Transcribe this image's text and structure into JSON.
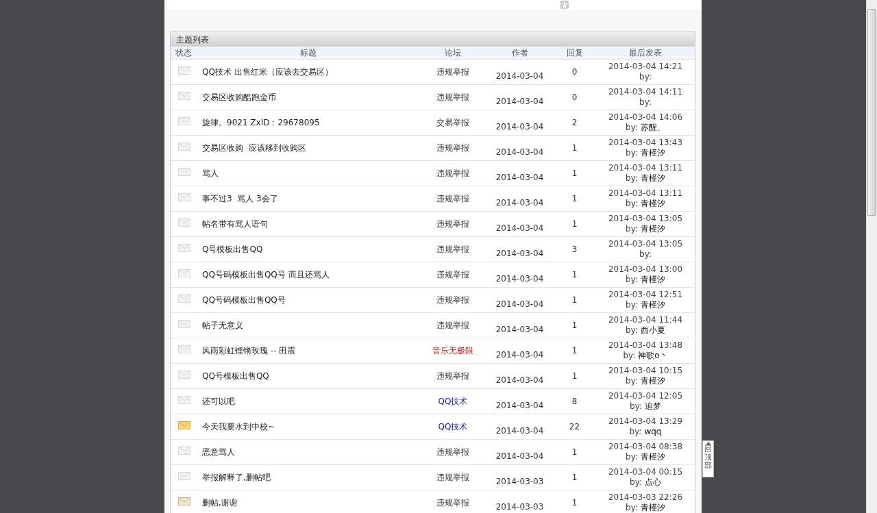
{
  "panel": {
    "title": "主题列表"
  },
  "columns": [
    "状态",
    "标题",
    "论坛",
    "作者",
    "回复",
    "最后发表"
  ],
  "rows": [
    {
      "kind": "plain",
      "title": "QQ技术 出售红米（应该去交易区）",
      "forum": "违规举报",
      "date": "2014-03-04",
      "replies": "0",
      "last_time": "2014-03-04 14:21",
      "by": "by:"
    },
    {
      "kind": "plain",
      "title": "交易区收购酷跑金币",
      "forum": "违规举报",
      "date": "2014-03-04",
      "replies": "0",
      "last_time": "2014-03-04 14:11",
      "by": "by:"
    },
    {
      "kind": "plain",
      "title": "旋律。9021 ZxID：29678095",
      "forum": "交易举报",
      "date": "2014-03-04",
      "replies": "2",
      "last_time": "2014-03-04 14:06",
      "by": "by:",
      "last_author": "苏醒、"
    },
    {
      "kind": "plain",
      "title": "交易区收购  应该移到收购区",
      "forum": "违规举报",
      "date": "2014-03-04",
      "replies": "1",
      "last_time": "2014-03-04 13:43",
      "by": "by:",
      "last_author": "青槿汐"
    },
    {
      "kind": "plain",
      "title": "骂人",
      "forum": "违规举报",
      "date": "2014-03-04",
      "replies": "1",
      "last_time": "2014-03-04 13:11",
      "by": "by:",
      "last_author": "青槿汐"
    },
    {
      "kind": "plain",
      "title": "事不过3  骂人 3会了",
      "forum": "违规举报",
      "date": "2014-03-04",
      "replies": "1",
      "last_time": "2014-03-04 13:11",
      "by": "by:",
      "last_author": "青槿汐"
    },
    {
      "kind": "plain",
      "title": "帖名带有骂人语句",
      "forum": "违规举报",
      "date": "2014-03-04",
      "replies": "1",
      "last_time": "2014-03-04 13:05",
      "by": "by:",
      "last_author": "青槿汐"
    },
    {
      "kind": "plain",
      "title": "Q号模板出售QQ",
      "forum": "违规举报",
      "date": "2014-03-04",
      "replies": "3",
      "last_time": "2014-03-04 13:05",
      "by": "by:"
    },
    {
      "kind": "plain",
      "title": "QQ号码模板出售QQ号 而且还骂人",
      "forum": "违规举报",
      "date": "2014-03-04",
      "replies": "1",
      "last_time": "2014-03-04 13:00",
      "by": "by:",
      "last_author": "青槿汐"
    },
    {
      "kind": "plain",
      "title": "QQ号码模板出售QQ号",
      "forum": "违规举报",
      "date": "2014-03-04",
      "replies": "1",
      "last_time": "2014-03-04 12:51",
      "by": "by:",
      "last_author": "青槿汐"
    },
    {
      "kind": "plain",
      "title": "帖子无意义",
      "forum": "违规举报",
      "date": "2014-03-04",
      "replies": "1",
      "last_time": "2014-03-04 11:44",
      "by": "by:",
      "last_author": "西小夏"
    },
    {
      "kind": "plain",
      "title": "风雨彩虹铿锵玫瑰 -- 田震",
      "forum": "音乐无极限",
      "color": "#aa2222",
      "date": "2014-03-04",
      "replies": "1",
      "last_time": "2014-03-04 13:48",
      "by": "by:",
      "last_author": "神歌o丶"
    },
    {
      "kind": "plain",
      "title": "QQ号模板出售QQ",
      "forum": "违规举报",
      "date": "2014-03-04",
      "replies": "1",
      "last_time": "2014-03-04 10:15",
      "by": "by:",
      "last_author": "青槿汐"
    },
    {
      "kind": "plain",
      "title": "还可以吧",
      "forum": "QQ技术",
      "color": "#1a1a99",
      "date": "2014-03-04",
      "replies": "8",
      "last_time": "2014-03-04 12:05",
      "by": "by:",
      "last_author": "追梦"
    },
    {
      "kind": "hot",
      "title": "今天我要水到中校~",
      "forum": "QQ技术",
      "color": "#1a1a99",
      "date": "2014-03-04",
      "replies": "22",
      "last_time": "2014-03-04 13:29",
      "by": "by:",
      "last_author": "wqq"
    },
    {
      "kind": "plain",
      "title": "恶意骂人",
      "forum": "违规举报",
      "date": "2014-03-04",
      "replies": "1",
      "last_time": "2014-03-04 08:38",
      "by": "by:",
      "last_author": "青槿汐"
    },
    {
      "kind": "plain",
      "title": "举报解释了,删帖吧",
      "forum": "违规举报",
      "date": "2014-03-03",
      "replies": "1",
      "last_time": "2014-03-04 00:15",
      "by": "by:",
      "last_author": "点心"
    },
    {
      "kind": "warm",
      "title": "删帖,谢谢",
      "forum": "违规举报",
      "date": "2014-03-03",
      "replies": "1",
      "last_time": "2014-03-03 22:26",
      "by": "by:",
      "last_author": "青槿汐"
    }
  ],
  "back_to_top": {
    "label": "回顶部"
  }
}
